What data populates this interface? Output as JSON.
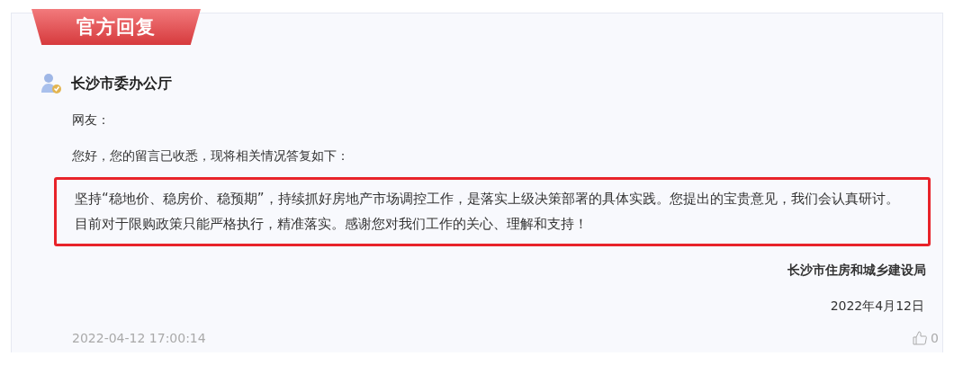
{
  "badge": "官方回复",
  "author": {
    "name": "长沙市委办公厅"
  },
  "greeting": "网友：",
  "intro": "您好，您的留言已收悉，现将相关情况答复如下：",
  "highlighted_paragraph": {
    "text": "坚持“稳地价、稳房价、稳预期”，持续抓好房地产市场调控工作，是落实上级决策部署的具体实践。您提出的宝贵意见，我们会认真研讨。目前对于限购政策只能严格执行，精准落实。感谢您对我们工作的关心、理解和支持！",
    "highlighted": true
  },
  "signature": "长沙市住房和城乡建设局",
  "signed_date": "2022年4月12日",
  "timestamp": "2022-04-12 17:00:14",
  "likes": "0"
}
